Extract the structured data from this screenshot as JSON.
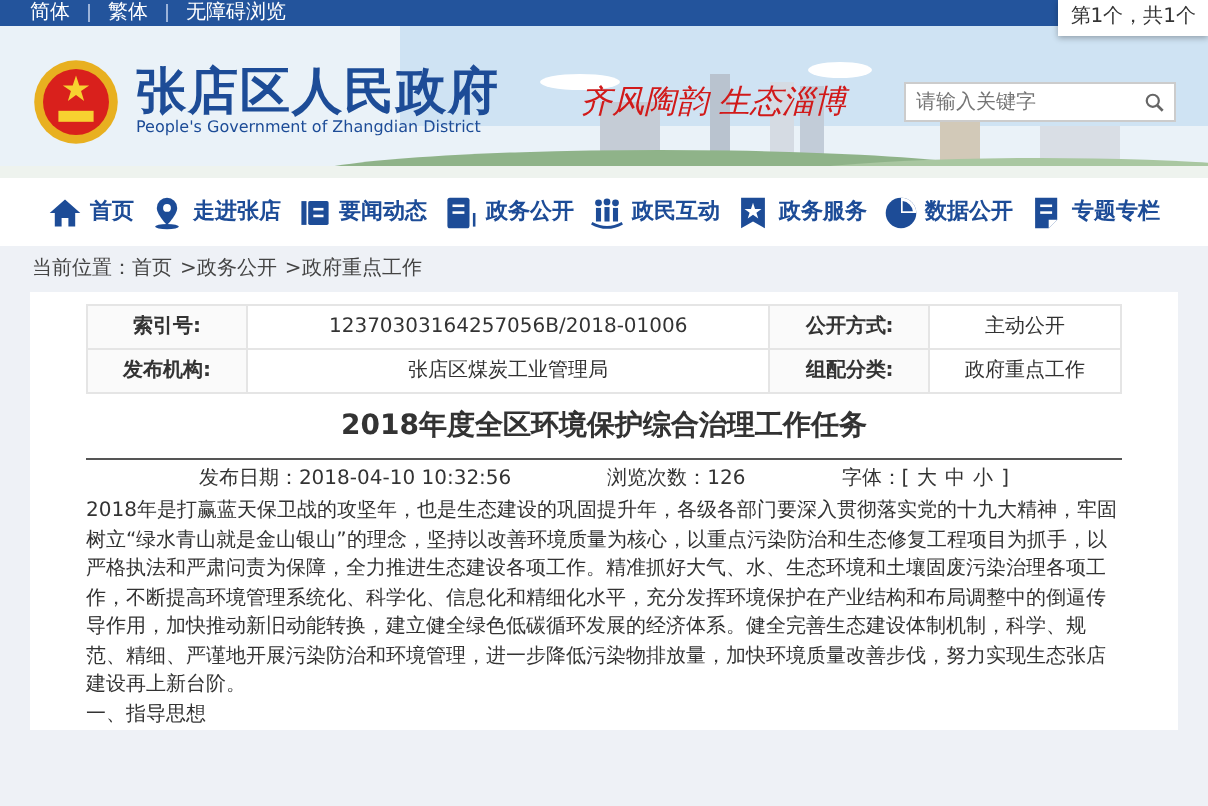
{
  "top_bar": {
    "links": [
      "简体",
      "繁体",
      "无障碍浏览"
    ]
  },
  "find_popup": {
    "text": "第1个，共1个"
  },
  "header": {
    "title": "张店区人民政府",
    "subtitle": "People's Government of Zhangdian District",
    "slogan": "齐风陶韵 生态淄博",
    "search": {
      "placeholder": "请输入关键字"
    }
  },
  "nav": [
    {
      "label": "首页"
    },
    {
      "label": "走进张店"
    },
    {
      "label": "要闻动态"
    },
    {
      "label": "政务公开"
    },
    {
      "label": "政民互动"
    },
    {
      "label": "政务服务"
    },
    {
      "label": "数据公开"
    },
    {
      "label": "专题专栏"
    }
  ],
  "breadcrumb": [
    "当前位置：首页",
    ">政务公开",
    ">政府重点工作"
  ],
  "info_table": [
    [
      "索引号:",
      "12370303164257056B/2018-01006",
      "公开方式:",
      "主动公开"
    ],
    [
      "发布机构:",
      "张店区煤炭工业管理局",
      "组配分类:",
      "政府重点工作"
    ]
  ],
  "article": {
    "title": "2018年度全区环境保护综合治理工作任务",
    "date": "发布日期：2018-04-10 10:32:56",
    "views": "浏览次数：126",
    "font_size": {
      "label": "字体：[",
      "options": [
        "大",
        "中",
        "小"
      ],
      "close": "]"
    },
    "paragraphs": [
      "2018年是打赢蓝天保卫战的攻坚年，也是生态建设的巩固提升年，各级各部门要深入贯彻落实党的十九大精神，牢固树立“绿水青山就是金山银山”的理念，坚持以改善环境质量为核心，以重点污染防治和生态修复工程项目为抓手，以严格执法和严肃问责为保障，全力推进生态建设各项工作。精准抓好大气、水、生态环境和土壤固废污染治理各项工作，不断提高环境管理系统化、科学化、信息化和精细化水平，充分发挥环境保护在产业结构和布局调整中的倒逼传导作用，加快推动新旧动能转换，建立健全绿色低碳循环发展的经济体系。健全完善生态建设体制机制，科学、规范、精细、严谨地开展污染防治和环境管理，进一步降低污染物排放量，加快环境质量改善步伐，努力实现生态张店建设再上新台阶。",
      "一、指导思想"
    ]
  }
}
